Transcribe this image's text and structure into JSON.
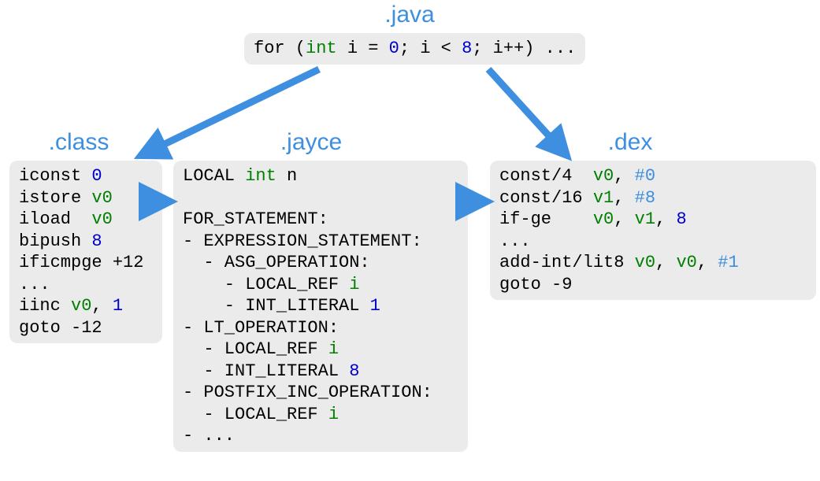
{
  "titles": {
    "java": ".java",
    "class": ".class",
    "jayce": ".jayce",
    "dex": ".dex"
  },
  "code": {
    "java": [
      [
        {
          "t": "for ("
        },
        {
          "t": "int",
          "c": "kw"
        },
        {
          "t": " i = "
        },
        {
          "t": "0",
          "c": "num"
        },
        {
          "t": "; i < "
        },
        {
          "t": "8",
          "c": "num"
        },
        {
          "t": "; i++) ..."
        }
      ]
    ],
    "class": [
      [
        {
          "t": "iconst "
        },
        {
          "t": "0",
          "c": "num"
        }
      ],
      [
        {
          "t": "istore "
        },
        {
          "t": "v0",
          "c": "reg"
        }
      ],
      [
        {
          "t": "iload  "
        },
        {
          "t": "v0",
          "c": "reg"
        }
      ],
      [
        {
          "t": "bipush "
        },
        {
          "t": "8",
          "c": "num"
        }
      ],
      [
        {
          "t": "ificmpge +12"
        }
      ],
      [
        {
          "t": "..."
        }
      ],
      [
        {
          "t": "iinc "
        },
        {
          "t": "v0",
          "c": "reg"
        },
        {
          "t": ", "
        },
        {
          "t": "1",
          "c": "num"
        }
      ],
      [
        {
          "t": "goto -12"
        }
      ]
    ],
    "jayce": [
      [
        {
          "t": "LOCAL "
        },
        {
          "t": "int",
          "c": "kw"
        },
        {
          "t": " n"
        }
      ],
      [
        {
          "t": ""
        }
      ],
      [
        {
          "t": "FOR_STATEMENT:"
        }
      ],
      [
        {
          "t": "- EXPRESSION_STATEMENT:"
        }
      ],
      [
        {
          "t": "  - ASG_OPERATION:"
        }
      ],
      [
        {
          "t": "    - LOCAL_REF "
        },
        {
          "t": "i",
          "c": "kw"
        }
      ],
      [
        {
          "t": "    - INT_LITERAL "
        },
        {
          "t": "1",
          "c": "num"
        }
      ],
      [
        {
          "t": "- LT_OPERATION:"
        }
      ],
      [
        {
          "t": "  - LOCAL_REF "
        },
        {
          "t": "i",
          "c": "kw"
        }
      ],
      [
        {
          "t": "  - INT_LITERAL "
        },
        {
          "t": "8",
          "c": "num"
        }
      ],
      [
        {
          "t": "- POSTFIX_INC_OPERATION:"
        }
      ],
      [
        {
          "t": "  - LOCAL_REF "
        },
        {
          "t": "i",
          "c": "kw"
        }
      ],
      [
        {
          "t": "- ..."
        }
      ]
    ],
    "dex": [
      [
        {
          "t": "const/4  "
        },
        {
          "t": "v0",
          "c": "reg"
        },
        {
          "t": ", "
        },
        {
          "t": "#0",
          "c": "hash"
        }
      ],
      [
        {
          "t": "const/16 "
        },
        {
          "t": "v1",
          "c": "reg"
        },
        {
          "t": ", "
        },
        {
          "t": "#8",
          "c": "hash"
        }
      ],
      [
        {
          "t": "if-ge    "
        },
        {
          "t": "v0",
          "c": "reg"
        },
        {
          "t": ", "
        },
        {
          "t": "v1",
          "c": "reg"
        },
        {
          "t": ", "
        },
        {
          "t": "8",
          "c": "num"
        }
      ],
      [
        {
          "t": "..."
        }
      ],
      [
        {
          "t": "add-int/lit8 "
        },
        {
          "t": "v0",
          "c": "reg"
        },
        {
          "t": ", "
        },
        {
          "t": "v0",
          "c": "reg"
        },
        {
          "t": ", "
        },
        {
          "t": "#1",
          "c": "hash"
        }
      ],
      [
        {
          "t": "goto -9"
        }
      ]
    ]
  }
}
